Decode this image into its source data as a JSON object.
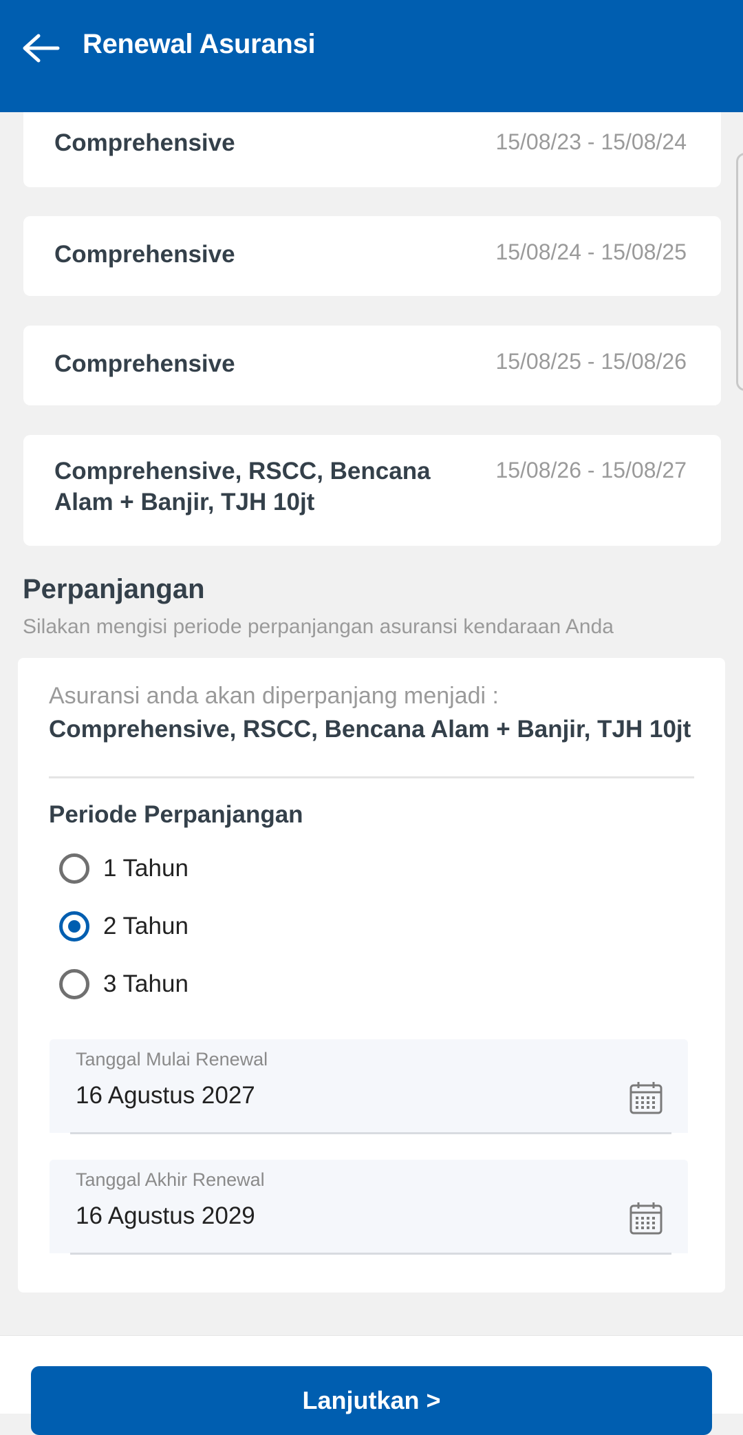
{
  "appbar": {
    "title": "Renewal Asuransi",
    "back_icon": "arrow-left-icon"
  },
  "history": [
    {
      "coverage": "Comprehensive",
      "period": "15/08/23 - 15/08/24"
    },
    {
      "coverage": "Comprehensive",
      "period": "15/08/24 - 15/08/25"
    },
    {
      "coverage": "Comprehensive",
      "period": "15/08/25 - 15/08/26"
    },
    {
      "coverage": "Comprehensive, RSCC, Bencana Alam + Banjir, TJH 10jt",
      "period": "15/08/26 - 15/08/27"
    }
  ],
  "perpanjangan": {
    "title": "Perpanjangan",
    "subtitle": "Silakan mengisi periode perpanjangan asuransi kendaraan Anda",
    "renew_label": "Asuransi anda akan diperpanjang menjadi :",
    "renew_value": "Comprehensive, RSCC, Bencana Alam + Banjir, TJH 10jt",
    "periode_label": "Periode Perpanjangan",
    "options": [
      {
        "label": "1 Tahun",
        "checked": false
      },
      {
        "label": "2 Tahun",
        "checked": true
      },
      {
        "label": "3 Tahun",
        "checked": false
      }
    ],
    "start_date": {
      "label": "Tanggal Mulai Renewal",
      "value": "16 Agustus 2027",
      "icon": "calendar-icon"
    },
    "end_date": {
      "label": "Tanggal Akhir Renewal",
      "value": "16 Agustus 2029",
      "icon": "calendar-icon"
    }
  },
  "footer": {
    "continue_label": "Lanjutkan >"
  },
  "colors": {
    "primary": "#005eb0",
    "background": "#f1f1f1",
    "text_dark": "#34404a",
    "text_muted": "#9a9a9a"
  }
}
